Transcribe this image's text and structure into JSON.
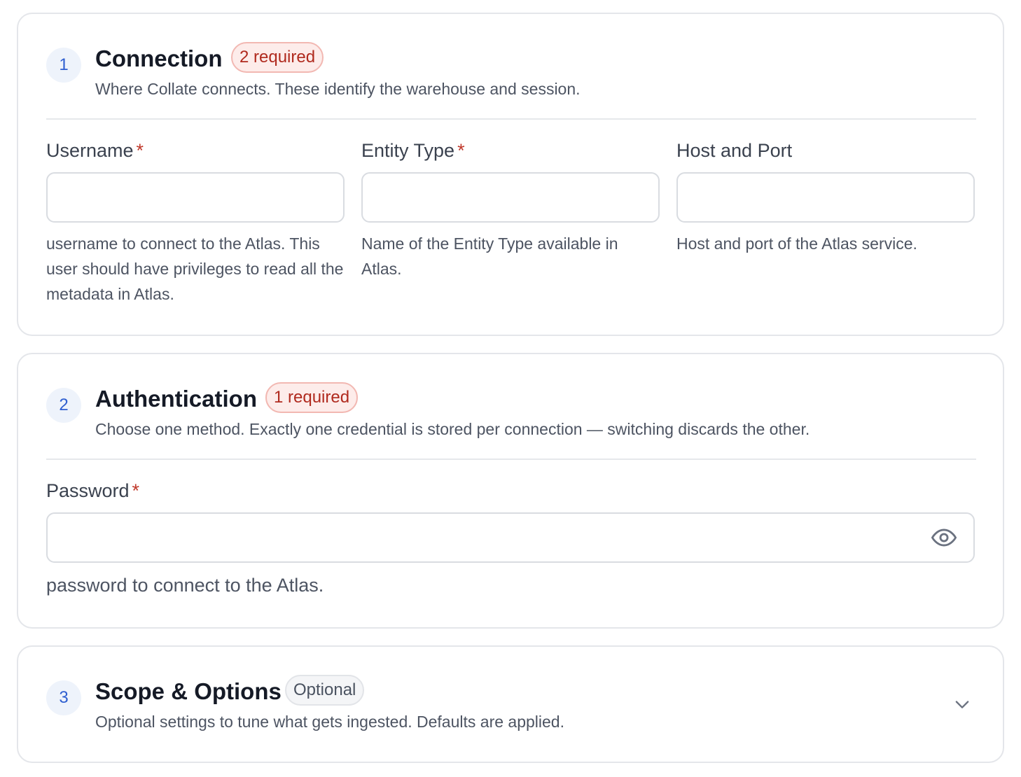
{
  "sections": [
    {
      "number": "1",
      "title": "Connection",
      "badge": "2 required",
      "description": "Where Collate connects. These identify the warehouse and session.",
      "fields": [
        {
          "label": "Username",
          "required_marker": "*",
          "value": "",
          "help": "username to connect to the Atlas. This user should have privileges to read all the metadata in Atlas."
        },
        {
          "label": "Entity Type",
          "required_marker": "*",
          "value": "",
          "help": "Name of the Entity Type available in Atlas."
        },
        {
          "label": "Host and Port",
          "value": "",
          "help": "Host and port of the Atlas service."
        }
      ]
    },
    {
      "number": "2",
      "title": "Authentication",
      "badge": "1 required",
      "description": "Choose one method. Exactly one credential is stored per connection — switching discards the other.",
      "fields": [
        {
          "label": "Password",
          "required_marker": "*",
          "value": "",
          "help": "password to connect to the Atlas.",
          "icon": "eye-icon"
        }
      ]
    },
    {
      "number": "3",
      "title": "Scope & Options",
      "badge": "Optional",
      "description": "Optional settings to tune what gets ingested. Defaults are applied.",
      "icon": "chevron-down-icon",
      "collapsed": true
    }
  ],
  "colors": {
    "accent": "#2f5fd0",
    "required": "#c0392b",
    "border": "#e4e6ea"
  }
}
